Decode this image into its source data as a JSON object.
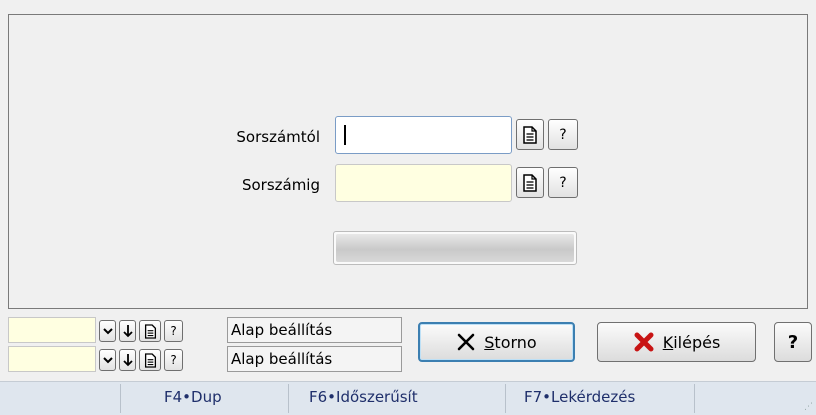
{
  "form": {
    "from_label": "Sorszámtól",
    "to_label": "Sorszámig",
    "from_value": "",
    "to_value": "",
    "help_glyph": "?"
  },
  "bottom_settings": [
    {
      "value": "",
      "label": "Alap beállítás"
    },
    {
      "value": "",
      "label": "Alap beállítás"
    }
  ],
  "buttons": {
    "storno_rest": "torno",
    "storno_mnemonic": "S",
    "exit_mnemonic": "K",
    "exit_rest": "ilépés",
    "help": "?"
  },
  "status_bar": {
    "f4": "F4•Dup",
    "f6": "F6•Időszerűsít",
    "f7": "F7•Lekérdezés"
  },
  "colors": {
    "input_inactive": "#ffffe1",
    "exit_icon": "#c81414",
    "status_bg": "#dfe6ee"
  }
}
